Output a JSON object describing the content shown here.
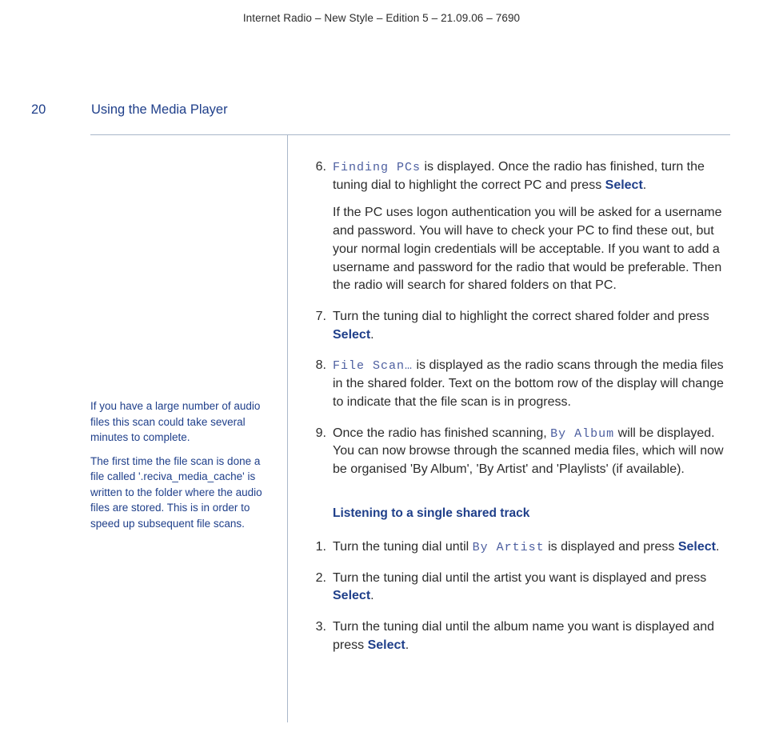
{
  "header_line": "Internet Radio – New Style – Edition 5 – 21.09.06 – 7690",
  "page_number": "20",
  "section_title": "Using the Media Player",
  "sidebar": {
    "p1": "If you have a large number of audio files this scan could take several minutes to complete.",
    "p2": "The first time the file scan is done a file called '.reciva_media_cache' is written to the folder where the audio files are stored. This is in order to speed up subsequent file scans."
  },
  "labels": {
    "select": "Select"
  },
  "terms": {
    "finding_pcs": "Finding PCs",
    "file_scan": "File Scan…",
    "by_album": "By Album",
    "by_artist": "By Artist"
  },
  "steps": {
    "s6_num": "6.",
    "s6_a_part1": " is displayed. Once the radio has finished, turn the tuning dial to highlight the correct PC and press ",
    "s6_a_part2": ".",
    "s6_b": "If the PC uses logon authentication you will be asked for a username and password. You will have to check your PC to find these out, but your normal login credentials will be acceptable. If you want to add a username and password for the radio that would be preferable. Then the radio will search for shared folders on that PC.",
    "s7_num": "7.",
    "s7_a": "Turn the tuning dial to highlight the correct shared folder and press ",
    "s7_b": ".",
    "s8_num": "8.",
    "s8_a": " is displayed as the radio scans through the media files in the shared folder. Text on the bottom row of the display will change to indicate that the file scan is in progress.",
    "s9_num": "9.",
    "s9_a": "Once the radio has finished scanning, ",
    "s9_b": " will be displayed. You can now browse through the scanned media files, which will now be organised 'By Album', 'By Artist' and 'Playlists' (if available)."
  },
  "subheading": "Listening to a single shared track",
  "substeps": {
    "t1_num": "1.",
    "t1_a": "Turn the tuning dial until ",
    "t1_b": " is displayed and press ",
    "t1_c": ".",
    "t2_num": "2.",
    "t2_a": "Turn the tuning dial until the artist you want is displayed and press ",
    "t2_b": ".",
    "t3_num": "3.",
    "t3_a": "Turn the tuning dial until the album name you want is displayed and press ",
    "t3_b": "."
  }
}
